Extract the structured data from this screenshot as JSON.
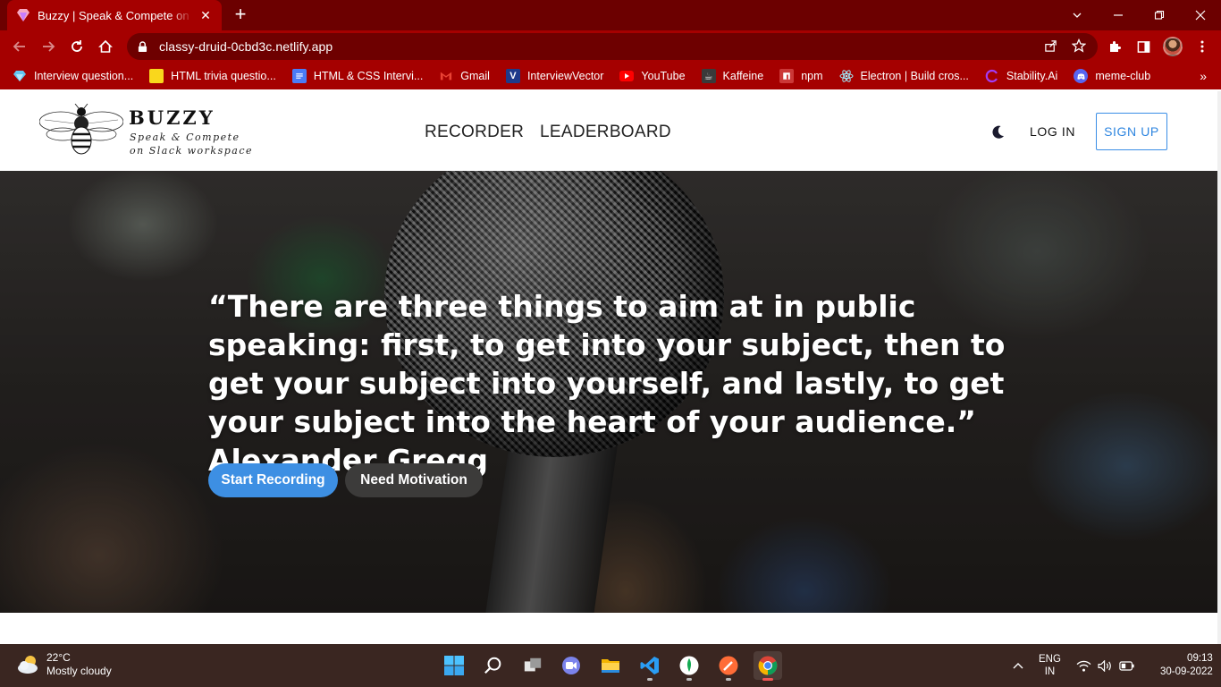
{
  "browser": {
    "tab_title": "Buzzy | Speak & Compete on slack workspace",
    "url": "classy-druid-0cbd3c.netlify.app",
    "bookmarks": [
      {
        "label": "Interview question...",
        "icon": "diamond-icon",
        "color": "#4fc3f7"
      },
      {
        "label": "HTML trivia questio...",
        "icon": "note-icon",
        "color": "#f9d71c"
      },
      {
        "label": "HTML & CSS Intervi...",
        "icon": "doc-icon",
        "color": "#4a7bf7"
      },
      {
        "label": "Gmail",
        "icon": "gmail-icon",
        "color": "#ea4335"
      },
      {
        "label": "InterviewVector",
        "icon": "v-icon",
        "color": "#1e3a8a"
      },
      {
        "label": "YouTube",
        "icon": "youtube-icon",
        "color": "#ff0000"
      },
      {
        "label": "Kaffeine",
        "icon": "kaffeine-icon",
        "color": "#3a3a3a"
      },
      {
        "label": "npm",
        "icon": "npm-icon",
        "color": "#cb3837"
      },
      {
        "label": "Electron | Build cros...",
        "icon": "electron-icon",
        "color": "#9feaf9"
      },
      {
        "label": "Stability.Ai",
        "icon": "stability-icon",
        "color": "#7b2ff7"
      },
      {
        "label": "meme-club",
        "icon": "discord-icon",
        "color": "#5865f2"
      }
    ]
  },
  "site": {
    "logo": {
      "title": "BUZZY",
      "tagline": "Speak & Compete on Slack workspace"
    },
    "nav": {
      "recorder": "RECORDER",
      "leaderboard": "LEADERBOARD",
      "login": "LOG IN",
      "signup": "SIGN UP"
    },
    "hero": {
      "quote": "“There are three things to aim at in public speaking: first, to get into your subject, then to get your subject into yourself, and lastly, to get your subject into the heart of your audience.” Alexander Gregg",
      "primary_button": "Start Recording",
      "secondary_button": "Need Motivation"
    }
  },
  "taskbar": {
    "weather_temp": "22°C",
    "weather_desc": "Mostly cloudy",
    "lang_top": "ENG",
    "lang_bottom": "IN",
    "time": "09:13",
    "date": "30-09-2022"
  },
  "colors": {
    "browser_frame": "#a50000",
    "accent_blue": "#3d8fe3",
    "taskbar": "#3a2621"
  }
}
